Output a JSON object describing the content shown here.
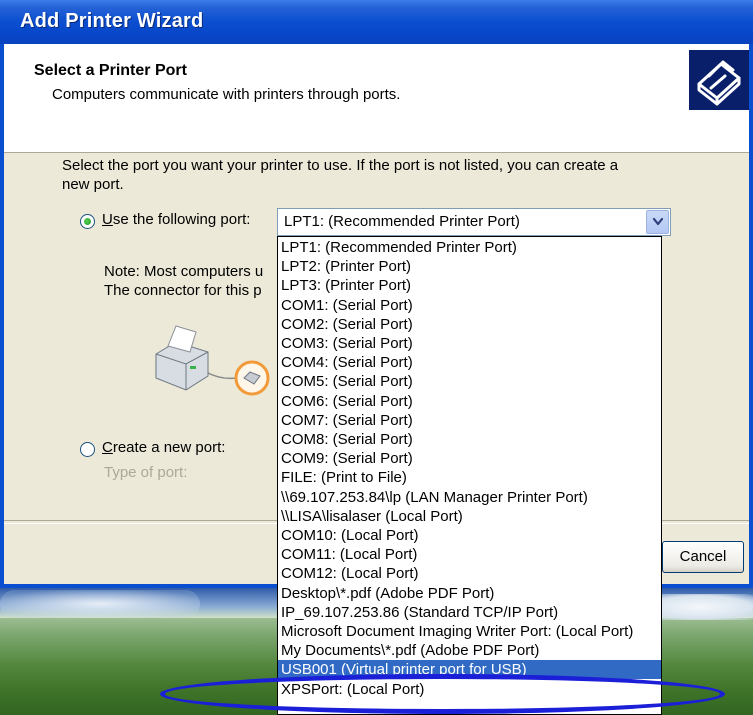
{
  "window": {
    "title": "Add Printer Wizard"
  },
  "header": {
    "title": "Select a Printer Port",
    "subtitle": "Computers communicate with printers through ports.",
    "icon": "printer-icon"
  },
  "body": {
    "instruction_line1": "Select the port you want your printer to use.  If the port is not listed, you can create a",
    "instruction_line2": "new port.",
    "use_port_label_u": "U",
    "use_port_label_rest": "se the following port:",
    "combo_value": "LPT1: (Recommended Printer Port)",
    "note_line1": "Note: Most computers u",
    "note_line2": "The connector for this p",
    "create_port_label_u": "C",
    "create_port_label_rest": "reate a new port:",
    "type_of_port_label": "Type of port:",
    "cancel_label": "ancel"
  },
  "dropdown": {
    "items": [
      "LPT1: (Recommended Printer Port)",
      "LPT2: (Printer Port)",
      "LPT3: (Printer Port)",
      "COM1: (Serial Port)",
      "COM2: (Serial Port)",
      "COM3: (Serial Port)",
      "COM4: (Serial Port)",
      "COM5: (Serial Port)",
      "COM6: (Serial Port)",
      "COM7: (Serial Port)",
      "COM8: (Serial Port)",
      "COM9: (Serial Port)",
      "FILE: (Print to File)",
      "\\\\69.107.253.84\\lp (LAN Manager Printer Port)",
      "\\\\LISA\\lisalaser (Local Port)",
      "COM10: (Local Port)",
      "COM11: (Local Port)",
      "COM12: (Local Port)",
      "Desktop\\*.pdf (Adobe PDF Port)",
      "IP_69.107.253.86 (Standard TCP/IP Port)",
      "Microsoft Document Imaging Writer Port: (Local Port)",
      "My Documents\\*.pdf (Adobe PDF Port)",
      "USB001 (Virtual printer port for USB)",
      "XPSPort: (Local Port)"
    ],
    "selected_index": 22
  },
  "colors": {
    "titlebar": "#0a4fd0",
    "selection": "#316ac5",
    "annotation": "#1b1fd8"
  }
}
